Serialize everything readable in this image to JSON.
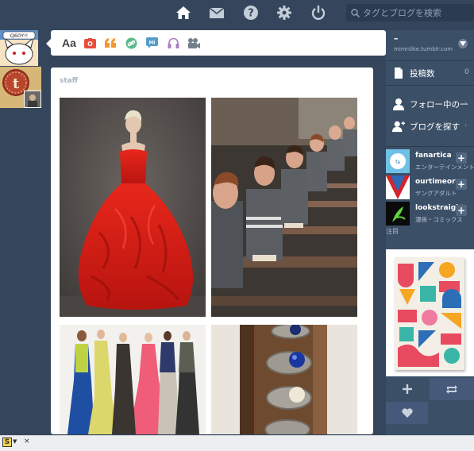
{
  "topbar": {
    "icons": [
      "home-icon",
      "mail-icon",
      "help-icon",
      "gear-icon",
      "power-icon"
    ],
    "search_placeholder": "タグとブログを検索"
  },
  "post_form": {
    "text_label": "Aa",
    "types": [
      "photo-icon",
      "quote-icon",
      "link-icon",
      "chat-icon",
      "audio-icon",
      "video-icon"
    ],
    "colors": {
      "photo": "#e94e3c",
      "quote": "#f2992e",
      "link": "#56bc8a",
      "chat": "#529ecc",
      "audio": "#a77dc2",
      "video": "#748089"
    }
  },
  "post": {
    "author": "staff"
  },
  "sidebar": {
    "blog": {
      "name": "–",
      "url": "mimnlike.tumblr.com"
    },
    "posts_label": "投稿数",
    "posts_count": "0",
    "following_label": "フォロー中の一",
    "explore_label": "ブログを探す",
    "recommended": [
      {
        "name": "fanartica",
        "category": "エンターテインメント"
      },
      {
        "name": "ourtimeorg",
        "category": "ヤングアダルト"
      },
      {
        "name": "lookstraight",
        "category": "漫画・コミックス"
      }
    ],
    "note_label": "注目"
  },
  "statusbar": {
    "icon_letter": "S",
    "close": "×"
  }
}
